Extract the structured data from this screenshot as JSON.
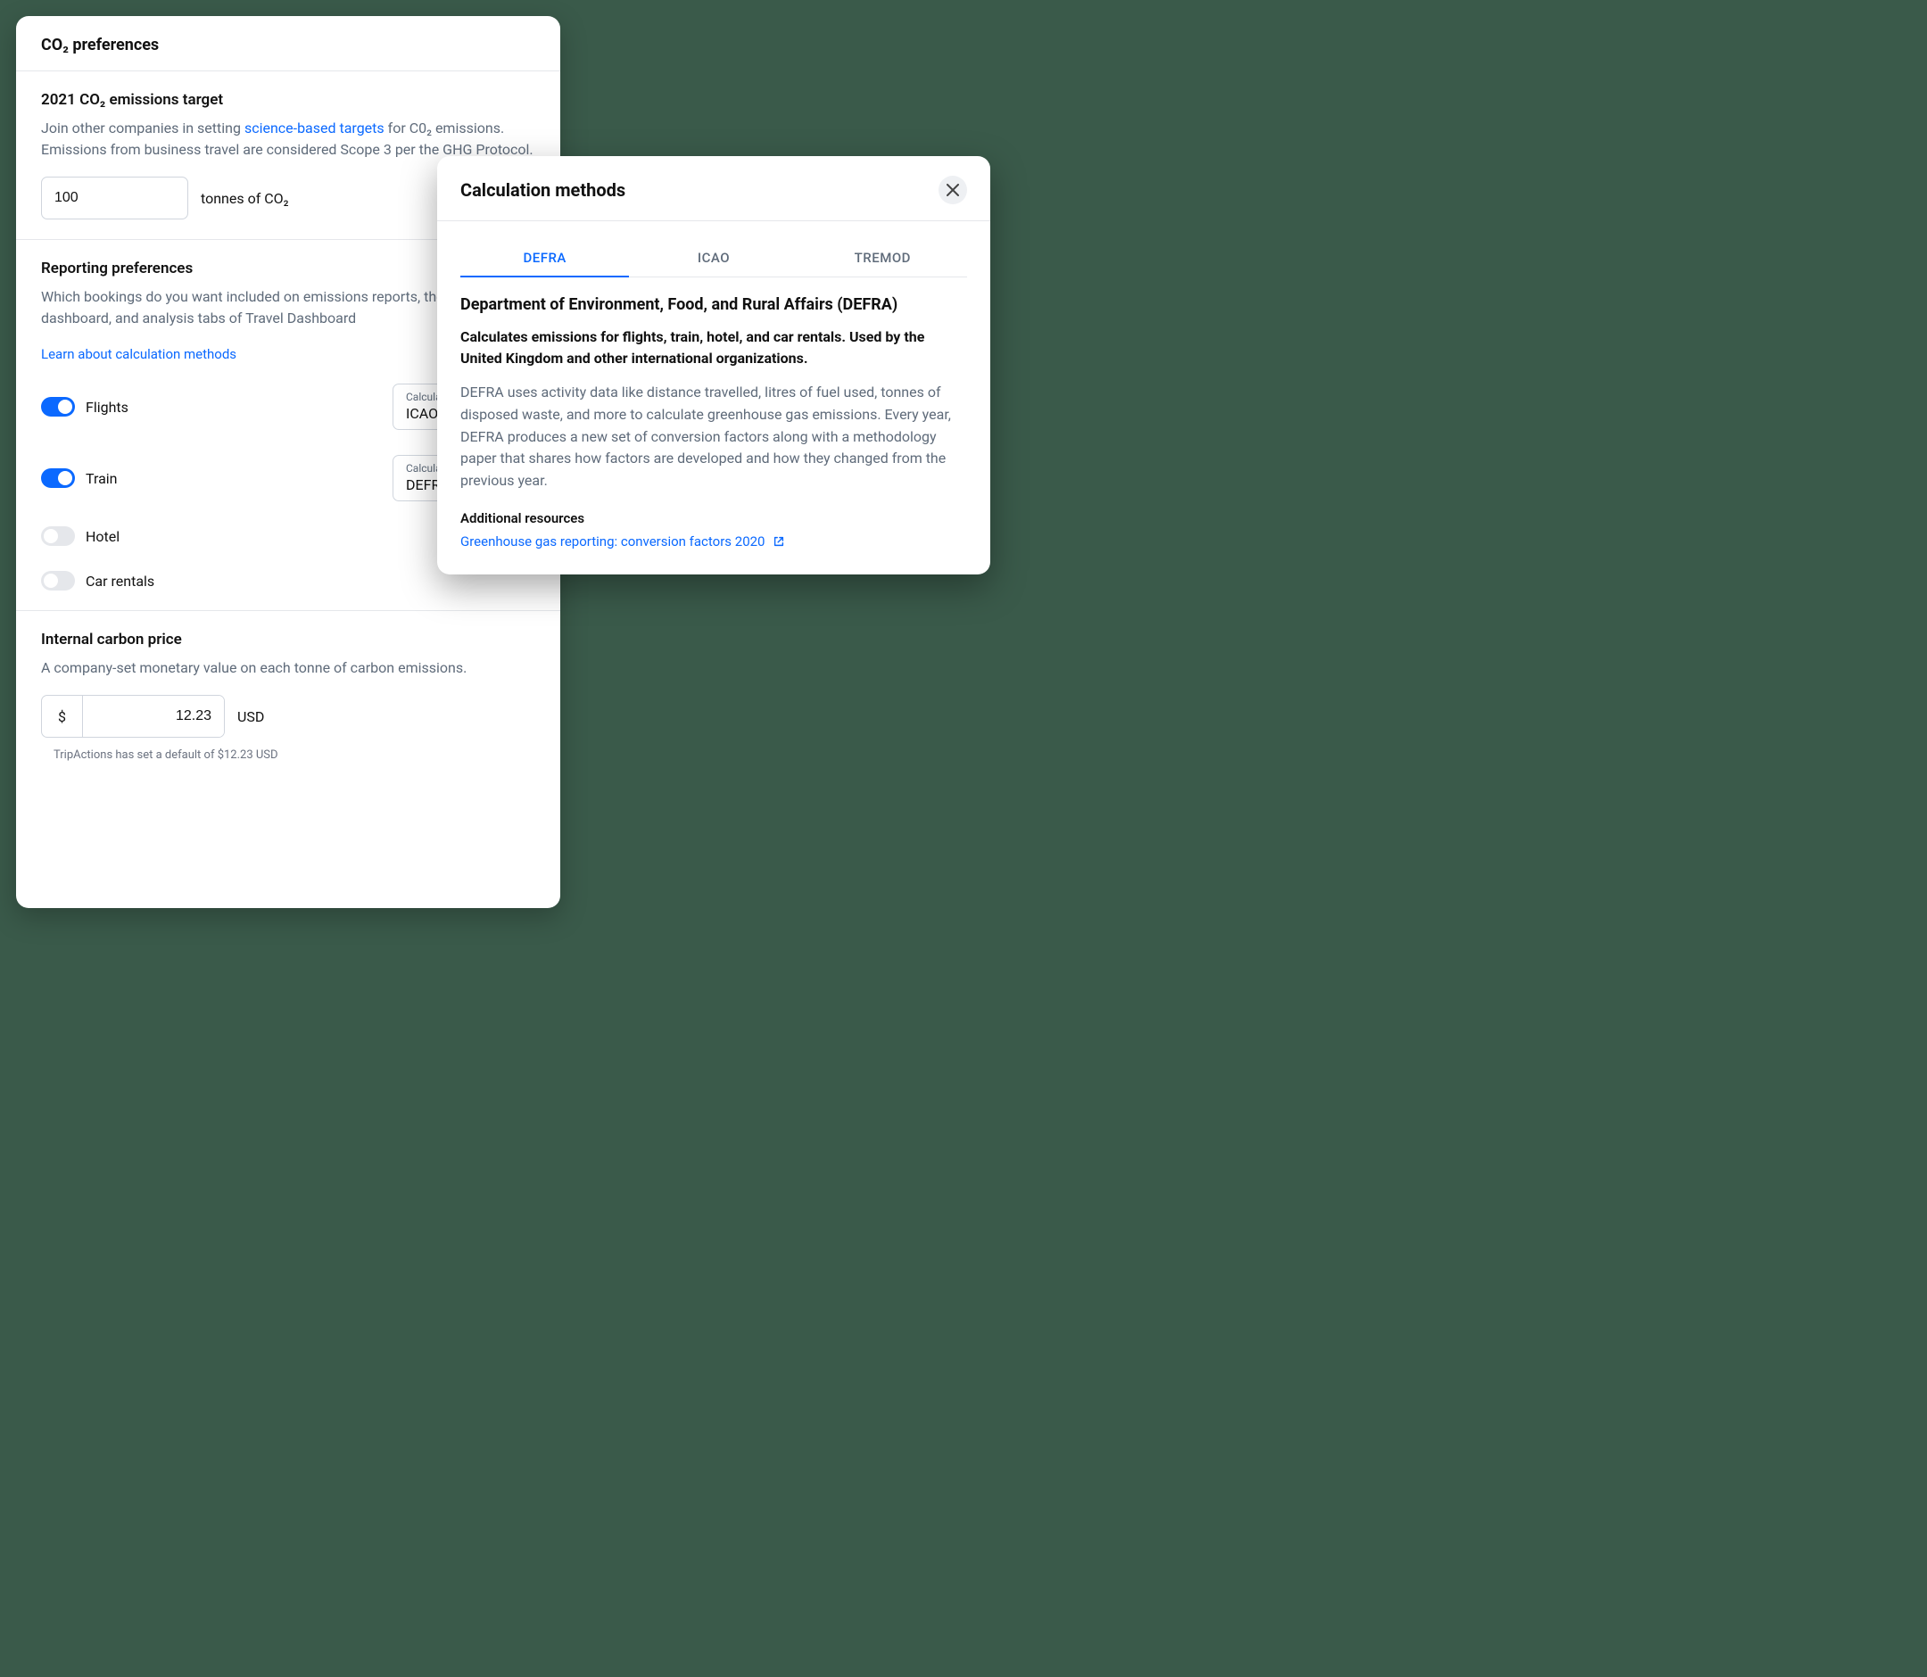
{
  "prefs": {
    "header_title": "CO₂ preferences",
    "target": {
      "heading": "2021 CO₂ emissions target",
      "desc_before": "Join other companies in setting ",
      "desc_link": "science-based targets",
      "desc_after": " for C0₂ emissions. Emissions from business travel are considered Scope 3 per the GHG Protocol.",
      "value": "100",
      "suffix": "tonnes of CO₂"
    },
    "reporting": {
      "heading": "Reporting preferences",
      "desc": "Which bookings do you want included on emissions reports, the performance dashboard, and analysis tabs of Travel Dashboard",
      "learn_link": "Learn about calculation methods",
      "items": [
        {
          "label": "Flights",
          "on": true,
          "method_label": "Calculation method",
          "method_value": "ICAO"
        },
        {
          "label": "Train",
          "on": true,
          "method_label": "Calculation method",
          "method_value": "DEFRA"
        },
        {
          "label": "Hotel",
          "on": false
        },
        {
          "label": "Car rentals",
          "on": false
        }
      ]
    },
    "carbon_price": {
      "heading": "Internal carbon price",
      "desc": "A company-set monetary value on each tonne of carbon emissions.",
      "currency_symbol": "$",
      "value": "12.23",
      "currency_code": "USD",
      "footnote": "TripActions has set a default of $12.23 USD"
    }
  },
  "methods": {
    "title": "Calculation methods",
    "tabs": [
      "DEFRA",
      "ICAO",
      "TREMOD"
    ],
    "active_tab": "DEFRA",
    "detail": {
      "heading": "Department of Environment, Food, and Rural Affairs (DEFRA)",
      "bold": "Calculates emissions for flights, train, hotel, and car rentals. Used by the United Kingdom and other international organizations.",
      "body": "DEFRA uses activity data like distance travelled, litres of fuel used, tonnes of disposed waste, and more to calculate greenhouse gas emissions. Every year, DEFRA produces a new set of conversion factors along with a methodology paper that shares how factors are developed and how they changed from the previous year.",
      "resources_label": "Additional resources",
      "resource_link": "Greenhouse gas reporting: conversion factors 2020"
    }
  }
}
